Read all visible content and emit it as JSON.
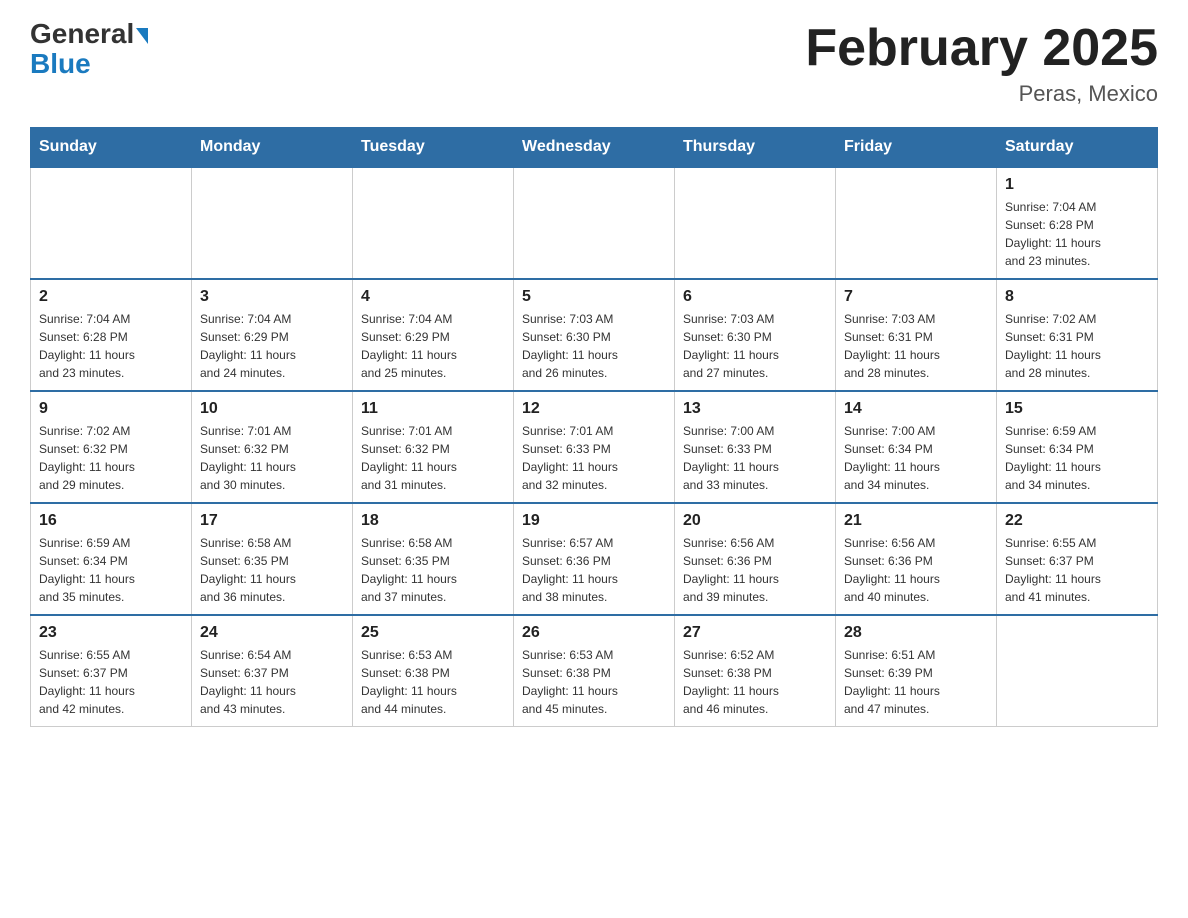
{
  "logo": {
    "part1": "General",
    "part2": "Blue"
  },
  "header": {
    "title": "February 2025",
    "location": "Peras, Mexico"
  },
  "weekdays": [
    "Sunday",
    "Monday",
    "Tuesday",
    "Wednesday",
    "Thursday",
    "Friday",
    "Saturday"
  ],
  "weeks": [
    [
      {
        "day": "",
        "info": ""
      },
      {
        "day": "",
        "info": ""
      },
      {
        "day": "",
        "info": ""
      },
      {
        "day": "",
        "info": ""
      },
      {
        "day": "",
        "info": ""
      },
      {
        "day": "",
        "info": ""
      },
      {
        "day": "1",
        "info": "Sunrise: 7:04 AM\nSunset: 6:28 PM\nDaylight: 11 hours\nand 23 minutes."
      }
    ],
    [
      {
        "day": "2",
        "info": "Sunrise: 7:04 AM\nSunset: 6:28 PM\nDaylight: 11 hours\nand 23 minutes."
      },
      {
        "day": "3",
        "info": "Sunrise: 7:04 AM\nSunset: 6:29 PM\nDaylight: 11 hours\nand 24 minutes."
      },
      {
        "day": "4",
        "info": "Sunrise: 7:04 AM\nSunset: 6:29 PM\nDaylight: 11 hours\nand 25 minutes."
      },
      {
        "day": "5",
        "info": "Sunrise: 7:03 AM\nSunset: 6:30 PM\nDaylight: 11 hours\nand 26 minutes."
      },
      {
        "day": "6",
        "info": "Sunrise: 7:03 AM\nSunset: 6:30 PM\nDaylight: 11 hours\nand 27 minutes."
      },
      {
        "day": "7",
        "info": "Sunrise: 7:03 AM\nSunset: 6:31 PM\nDaylight: 11 hours\nand 28 minutes."
      },
      {
        "day": "8",
        "info": "Sunrise: 7:02 AM\nSunset: 6:31 PM\nDaylight: 11 hours\nand 28 minutes."
      }
    ],
    [
      {
        "day": "9",
        "info": "Sunrise: 7:02 AM\nSunset: 6:32 PM\nDaylight: 11 hours\nand 29 minutes."
      },
      {
        "day": "10",
        "info": "Sunrise: 7:01 AM\nSunset: 6:32 PM\nDaylight: 11 hours\nand 30 minutes."
      },
      {
        "day": "11",
        "info": "Sunrise: 7:01 AM\nSunset: 6:32 PM\nDaylight: 11 hours\nand 31 minutes."
      },
      {
        "day": "12",
        "info": "Sunrise: 7:01 AM\nSunset: 6:33 PM\nDaylight: 11 hours\nand 32 minutes."
      },
      {
        "day": "13",
        "info": "Sunrise: 7:00 AM\nSunset: 6:33 PM\nDaylight: 11 hours\nand 33 minutes."
      },
      {
        "day": "14",
        "info": "Sunrise: 7:00 AM\nSunset: 6:34 PM\nDaylight: 11 hours\nand 34 minutes."
      },
      {
        "day": "15",
        "info": "Sunrise: 6:59 AM\nSunset: 6:34 PM\nDaylight: 11 hours\nand 34 minutes."
      }
    ],
    [
      {
        "day": "16",
        "info": "Sunrise: 6:59 AM\nSunset: 6:34 PM\nDaylight: 11 hours\nand 35 minutes."
      },
      {
        "day": "17",
        "info": "Sunrise: 6:58 AM\nSunset: 6:35 PM\nDaylight: 11 hours\nand 36 minutes."
      },
      {
        "day": "18",
        "info": "Sunrise: 6:58 AM\nSunset: 6:35 PM\nDaylight: 11 hours\nand 37 minutes."
      },
      {
        "day": "19",
        "info": "Sunrise: 6:57 AM\nSunset: 6:36 PM\nDaylight: 11 hours\nand 38 minutes."
      },
      {
        "day": "20",
        "info": "Sunrise: 6:56 AM\nSunset: 6:36 PM\nDaylight: 11 hours\nand 39 minutes."
      },
      {
        "day": "21",
        "info": "Sunrise: 6:56 AM\nSunset: 6:36 PM\nDaylight: 11 hours\nand 40 minutes."
      },
      {
        "day": "22",
        "info": "Sunrise: 6:55 AM\nSunset: 6:37 PM\nDaylight: 11 hours\nand 41 minutes."
      }
    ],
    [
      {
        "day": "23",
        "info": "Sunrise: 6:55 AM\nSunset: 6:37 PM\nDaylight: 11 hours\nand 42 minutes."
      },
      {
        "day": "24",
        "info": "Sunrise: 6:54 AM\nSunset: 6:37 PM\nDaylight: 11 hours\nand 43 minutes."
      },
      {
        "day": "25",
        "info": "Sunrise: 6:53 AM\nSunset: 6:38 PM\nDaylight: 11 hours\nand 44 minutes."
      },
      {
        "day": "26",
        "info": "Sunrise: 6:53 AM\nSunset: 6:38 PM\nDaylight: 11 hours\nand 45 minutes."
      },
      {
        "day": "27",
        "info": "Sunrise: 6:52 AM\nSunset: 6:38 PM\nDaylight: 11 hours\nand 46 minutes."
      },
      {
        "day": "28",
        "info": "Sunrise: 6:51 AM\nSunset: 6:39 PM\nDaylight: 11 hours\nand 47 minutes."
      },
      {
        "day": "",
        "info": ""
      }
    ]
  ]
}
